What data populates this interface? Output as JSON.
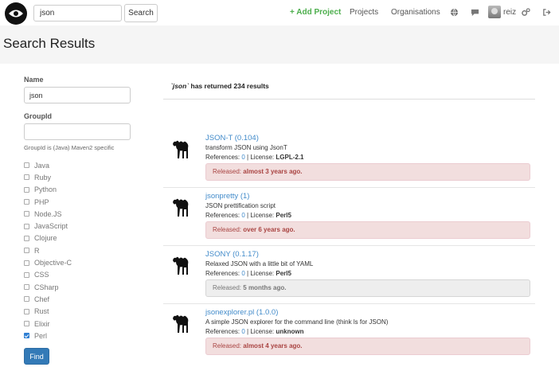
{
  "navbar": {
    "search_value": "json",
    "search_button": "Search",
    "add_project": "+ Add Project",
    "projects": "Projects",
    "organisations": "Organisations",
    "username": "reiz",
    "icons": [
      "globe-icon",
      "chat-icon",
      "gear-icon",
      "sign-out-icon"
    ]
  },
  "page_title": "Search Results",
  "filters": {
    "name_label": "Name",
    "name_value": "json",
    "groupid_label": "GroupId",
    "groupid_value": "",
    "groupid_help": "GroupId is (Java) Maven2 specific",
    "languages": [
      {
        "label": "Java",
        "checked": false
      },
      {
        "label": "Ruby",
        "checked": false
      },
      {
        "label": "Python",
        "checked": false
      },
      {
        "label": "PHP",
        "checked": false
      },
      {
        "label": "Node.JS",
        "checked": false
      },
      {
        "label": "JavaScript",
        "checked": false
      },
      {
        "label": "Clojure",
        "checked": false
      },
      {
        "label": "R",
        "checked": false
      },
      {
        "label": "Objective-C",
        "checked": false
      },
      {
        "label": "CSS",
        "checked": false
      },
      {
        "label": "CSharp",
        "checked": false
      },
      {
        "label": "Chef",
        "checked": false
      },
      {
        "label": "Rust",
        "checked": false
      },
      {
        "label": "Elixir",
        "checked": false
      },
      {
        "label": "Perl",
        "checked": true
      }
    ],
    "find_button": "Find"
  },
  "results": {
    "summary_query": "`json`",
    "summary_text": "has returned 234 results",
    "references_label": "References:",
    "license_label": "License:",
    "released_label": "Released:",
    "items": [
      {
        "name": "JSON-T (0.104)",
        "description": "transform JSON using JsonT",
        "references": "0",
        "license": "LGPL-2.1",
        "released": "almost 3 years ago.",
        "status": "old"
      },
      {
        "name": "jsonpretty (1)",
        "description": "JSON prettification script",
        "references": "0",
        "license": "Perl5",
        "released": "over 6 years ago.",
        "status": "old"
      },
      {
        "name": "JSONY (0.1.17)",
        "description": "Relaxed JSON with a little bit of YAML",
        "references": "0",
        "license": "Perl5",
        "released": "5 months ago.",
        "status": "recent"
      },
      {
        "name": "jsonexplorer.pl (1.0.0)",
        "description": "A simple JSON explorer for the command line (think ls for JSON)",
        "references": "0",
        "license": "unknown",
        "released": "almost 4 years ago.",
        "status": "old"
      }
    ]
  },
  "colors": {
    "link": "#428bca",
    "add_project": "#4cae4c",
    "release_old_bg": "#f2dede",
    "release_old_text": "#a94442",
    "release_recent_bg": "#eeeeee",
    "find_button_bg": "#337ab7"
  }
}
